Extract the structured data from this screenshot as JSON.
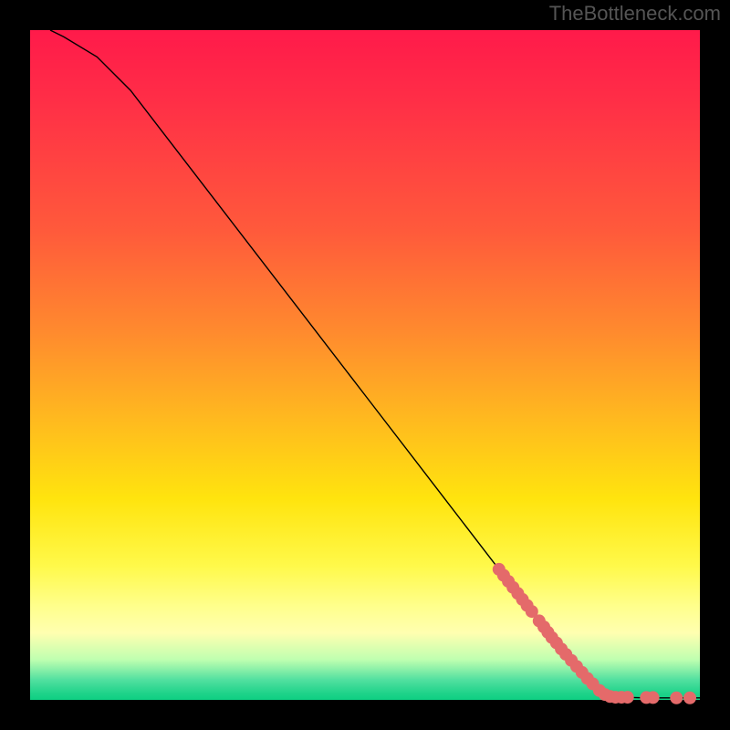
{
  "watermark": "TheBottleneck.com",
  "chart_data": {
    "type": "line",
    "title": "",
    "xlabel": "",
    "ylabel": "",
    "xlim": [
      0,
      100
    ],
    "ylim": [
      0,
      100
    ],
    "curve": [
      {
        "x": 3,
        "y": 100
      },
      {
        "x": 5,
        "y": 99
      },
      {
        "x": 10,
        "y": 96
      },
      {
        "x": 15,
        "y": 91
      },
      {
        "x": 20,
        "y": 84.5
      },
      {
        "x": 30,
        "y": 71.5
      },
      {
        "x": 40,
        "y": 58.5
      },
      {
        "x": 50,
        "y": 45.5
      },
      {
        "x": 60,
        "y": 32.5
      },
      {
        "x": 70,
        "y": 19.5
      },
      {
        "x": 78,
        "y": 9.0
      },
      {
        "x": 82,
        "y": 4.5
      },
      {
        "x": 85,
        "y": 1.3
      },
      {
        "x": 88,
        "y": 0.4
      },
      {
        "x": 92,
        "y": 0.3
      },
      {
        "x": 96,
        "y": 0.3
      },
      {
        "x": 100,
        "y": 0.3
      }
    ],
    "markers": [
      {
        "x": 70.0,
        "y": 19.5
      },
      {
        "x": 70.7,
        "y": 18.6
      },
      {
        "x": 71.4,
        "y": 17.7
      },
      {
        "x": 72.1,
        "y": 16.8
      },
      {
        "x": 72.8,
        "y": 15.9
      },
      {
        "x": 73.5,
        "y": 15.0
      },
      {
        "x": 74.2,
        "y": 14.1
      },
      {
        "x": 74.9,
        "y": 13.2
      },
      {
        "x": 76.0,
        "y": 11.8
      },
      {
        "x": 76.7,
        "y": 10.9
      },
      {
        "x": 77.3,
        "y": 10.1
      },
      {
        "x": 77.9,
        "y": 9.3
      },
      {
        "x": 78.6,
        "y": 8.5
      },
      {
        "x": 79.3,
        "y": 7.6
      },
      {
        "x": 80.0,
        "y": 6.8
      },
      {
        "x": 80.8,
        "y": 5.9
      },
      {
        "x": 81.6,
        "y": 5.0
      },
      {
        "x": 82.4,
        "y": 4.1
      },
      {
        "x": 83.2,
        "y": 3.2
      },
      {
        "x": 84.0,
        "y": 2.4
      },
      {
        "x": 85.0,
        "y": 1.4
      },
      {
        "x": 85.8,
        "y": 0.8
      },
      {
        "x": 86.6,
        "y": 0.5
      },
      {
        "x": 87.4,
        "y": 0.4
      },
      {
        "x": 88.3,
        "y": 0.4
      },
      {
        "x": 89.2,
        "y": 0.4
      },
      {
        "x": 92.0,
        "y": 0.35
      },
      {
        "x": 93.0,
        "y": 0.35
      },
      {
        "x": 96.5,
        "y": 0.3
      },
      {
        "x": 98.5,
        "y": 0.3
      }
    ],
    "marker_color": "#e46a6a"
  }
}
